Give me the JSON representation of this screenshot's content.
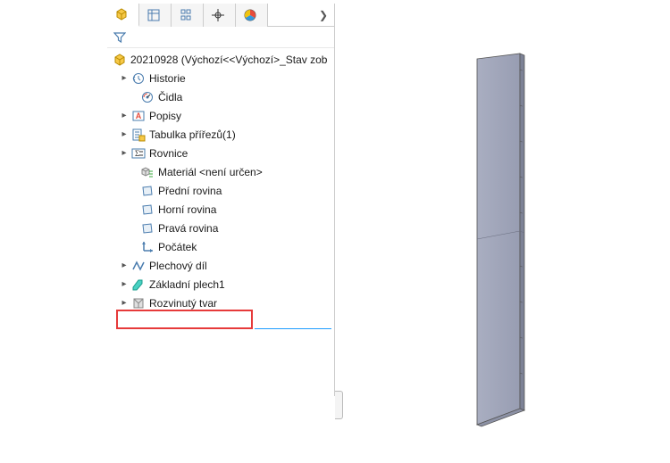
{
  "tabs": {
    "chevron": "❯"
  },
  "root": {
    "label": "20210928  (Výchozí<<Výchozí>_Stav zob"
  },
  "tree": {
    "historie": "Historie",
    "cidla": "Čidla",
    "popisy": "Popisy",
    "tabulka": "Tabulka přířezů(1)",
    "rovnice": "Rovnice",
    "material": "Materiál <není určen>",
    "predni": "Přední rovina",
    "horni": "Horní rovina",
    "prava": "Pravá rovina",
    "pocatek": "Počátek",
    "plechovy": "Plechový díl",
    "zakladni": "Základní plech1",
    "rozvinuty": "Rozvinutý tvar"
  }
}
